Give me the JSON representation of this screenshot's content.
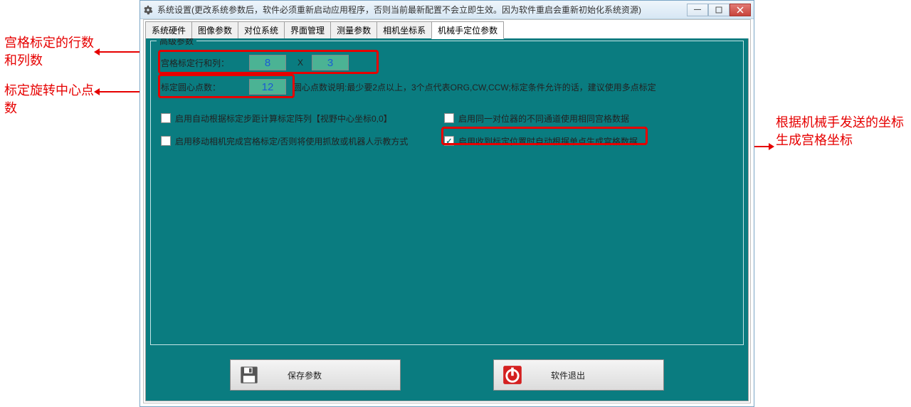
{
  "annotations": {
    "left1": "宫格标定的行数和列数",
    "left2": "标定旋转中心点数",
    "right": "根据机械手发送的坐标生成宫格坐标"
  },
  "window": {
    "title": "系统设置(更改系统参数后，软件必须重新启动应用程序，否则当前最新配置不会立即生效。因为软件重启会重新初始化系统资源)"
  },
  "tabs": [
    "系统硬件",
    "图像参数",
    "对位系统",
    "界面管理",
    "测量参数",
    "相机坐标系",
    "机械手定位参数"
  ],
  "active_tab": 6,
  "panel": {
    "legend": "高级参数",
    "grid_label": "宫格标定行和列：",
    "grid_rows": "8",
    "grid_sep": "X",
    "grid_cols": "3",
    "center_label": "标定圆心点数：",
    "center_value": "12",
    "center_note": "圆心点数说明:最少要2点以上，3个点代表ORG,CW,CCW;标定条件允许的话，建议使用多点标定",
    "chk1": {
      "label": "启用自动根据标定步距计算标定阵列【视野中心坐标0,0】",
      "checked": false
    },
    "chk2": {
      "label": "启用移动相机完成宫格标定/否则将使用抓放或机器人示教方式",
      "checked": false
    },
    "chk3": {
      "label": "启用同一对位器的不同通道使用相同宫格数据",
      "checked": false
    },
    "chk4": {
      "label": "启用收到标定位置时自动根据单点生成宫格数据",
      "checked": true
    }
  },
  "buttons": {
    "save": "保存参数",
    "exit": "软件退出"
  }
}
